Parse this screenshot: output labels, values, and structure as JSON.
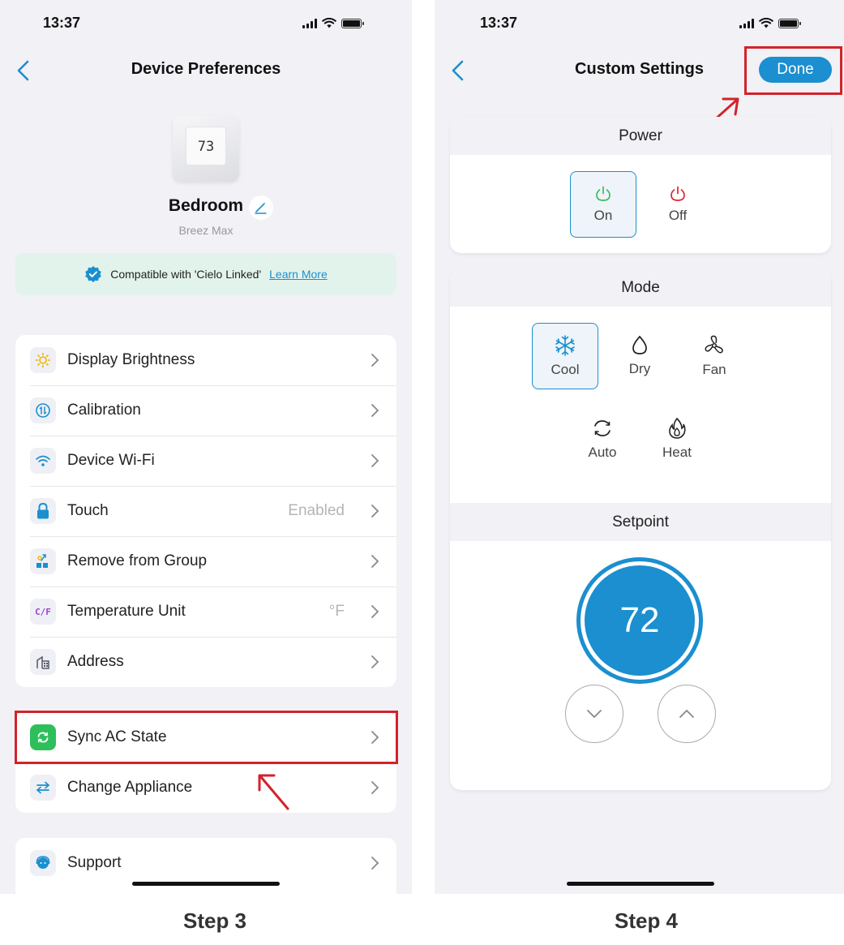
{
  "left": {
    "status": {
      "time": "13:37"
    },
    "nav": {
      "title": "Device Preferences"
    },
    "device": {
      "display": "73",
      "name": "Bedroom",
      "model": "Breez Max"
    },
    "compat": {
      "text": "Compatible with 'Cielo Linked'",
      "link": "Learn More"
    },
    "settings": [
      {
        "label": "Display Brightness",
        "value": "",
        "icon": "sun-icon"
      },
      {
        "label": "Calibration",
        "value": "",
        "icon": "calibration-icon"
      },
      {
        "label": "Device Wi-Fi",
        "value": "",
        "icon": "wifi-icon"
      },
      {
        "label": "Touch",
        "value": "Enabled",
        "icon": "lock-icon"
      },
      {
        "label": "Remove from Group",
        "value": "",
        "icon": "group-icon"
      },
      {
        "label": "Temperature Unit",
        "value": "°F",
        "icon": "cf-icon"
      },
      {
        "label": "Address",
        "value": "",
        "icon": "building-icon"
      }
    ],
    "sync": [
      {
        "label": "Sync AC State",
        "icon": "sync-icon"
      },
      {
        "label": "Change Appliance",
        "icon": "swap-icon"
      }
    ],
    "support": {
      "label": "Support",
      "icon": "support-icon"
    }
  },
  "right": {
    "status": {
      "time": "13:37"
    },
    "nav": {
      "title": "Custom Settings",
      "done": "Done"
    },
    "power": {
      "title": "Power",
      "on": "On",
      "off": "Off",
      "selected": "On"
    },
    "mode": {
      "title": "Mode",
      "cool": "Cool",
      "dry": "Dry",
      "fan": "Fan",
      "auto": "Auto",
      "heat": "Heat",
      "selected": "Cool"
    },
    "setpoint": {
      "title": "Setpoint",
      "value": "72"
    }
  },
  "captions": {
    "left": "Step 3",
    "right": "Step 4"
  },
  "colors": {
    "accent": "#1b8fcf",
    "highlight": "#d2232a",
    "on_green": "#3dbb5c",
    "off_red": "#e0262a"
  }
}
